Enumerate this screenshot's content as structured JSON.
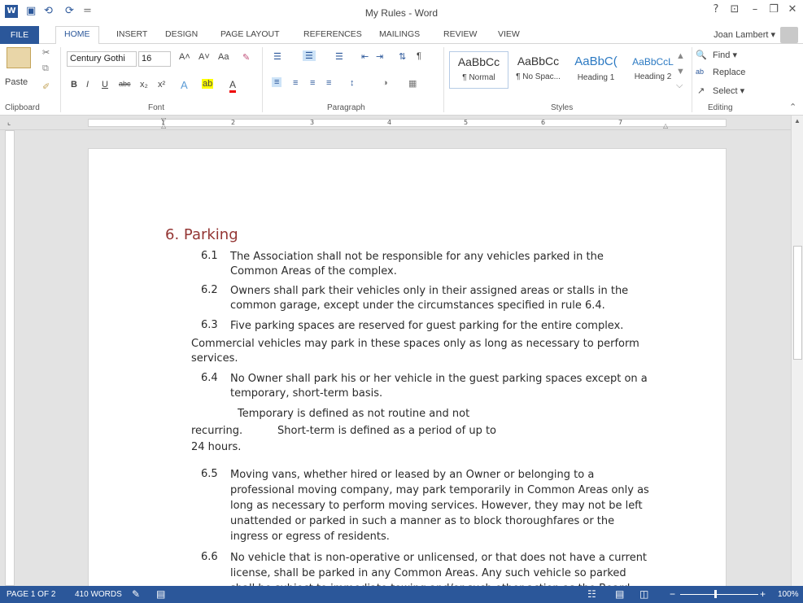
{
  "titlebar": {
    "title": "My Rules - Word",
    "help": "?",
    "ribbon_display": "⊡",
    "minimize": "–",
    "restore": "🗗",
    "close": "✕",
    "undo": "⟲",
    "redo": "⟳",
    "save": "💾",
    "customize": "="
  },
  "tabs": [
    "FILE",
    "HOME",
    "INSERT",
    "DESIGN",
    "PAGE LAYOUT",
    "REFERENCES",
    "MAILINGS",
    "REVIEW",
    "VIEW"
  ],
  "user": {
    "name": "Joan Lambert ▾"
  },
  "ribbon": {
    "clipboard": {
      "paste": "Paste",
      "label": "Clipboard"
    },
    "font": {
      "name": "Century Gothi",
      "size": "16",
      "label": "Font",
      "bold": "B",
      "italic": "I",
      "underline": "U",
      "strike": "abc",
      "sub": "x₂",
      "sup": "x²",
      "grow": "A˄",
      "shrink": "A˅",
      "case": "Aa",
      "clear": "✎",
      "effects": "A",
      "highlight": "ab",
      "color": "A"
    },
    "paragraph": {
      "label": "Paragraph"
    },
    "styles": {
      "label": "Styles",
      "items": [
        {
          "sample": "AaBbCc",
          "name": "¶ Normal"
        },
        {
          "sample": "AaBbCc",
          "name": "¶ No Spac..."
        },
        {
          "sample": "AaBbC(",
          "name": "Heading 1"
        },
        {
          "sample": "AaBbCcL",
          "name": "Heading 2"
        }
      ]
    },
    "editing": {
      "label": "Editing",
      "find": "Find ▾",
      "replace": "Replace",
      "select": "Select ▾"
    }
  },
  "ruler_numbers": [
    "1",
    "2",
    "3",
    "4",
    "5",
    "6",
    "7"
  ],
  "doc": {
    "heading": "6. Parking",
    "p61_num": "6.1",
    "p61_l1": "The Association shall not be responsible for any vehicles parked in the",
    "p61_l2": "Common Areas of the complex.",
    "p62_num": "6.2",
    "p62_l1": "Owners shall park their vehicles only in their assigned areas or stalls in the",
    "p62_l2": "common garage, except under the circumstances specified in rule 6.4.",
    "p63_num": "6.3",
    "p63_l1": "Five parking spaces are reserved for guest parking for the entire complex.",
    "p63_l2": "Commercial vehicles may park in these spaces only as long as necessary to perform",
    "p63_l3": "services.",
    "p64_num": "6.4",
    "p64_l1": "No Owner shall park his or her vehicle in the guest parking spaces except on a",
    "p64_l2": "temporary, short-term basis.",
    "p64_b1": "",
    "p64_b1_text": "Temporary is defined as not routine and not",
    "p64_b2_text": "recurring.",
    "p64_b2": "",
    "p64_b3_text": "Short-term is defined as a period of up to",
    "p64_b4": "24 hours.",
    "p65_num": "6.5",
    "p65_l1": "Moving vans, whether hired or leased by an Owner or belonging to a",
    "p65_l2": "professional moving company, may park temporarily in Common Areas only as",
    "p65_l3": "long as necessary to perform moving services. However, they may not be left",
    "p65_l4": "unattended or parked in such a manner as to block thoroughfares or the",
    "p65_l5": "ingress or egress of residents.",
    "p66_num": "6.6",
    "p66_l1": "No vehicle that is non-operative or unlicensed, or that does not have a current",
    "p66_l2": "license, shall be parked in any Common Areas. Any such vehicle so parked",
    "p66_l3": "shall be subject to immediate towing and/or such other action as the Board"
  },
  "status": {
    "page": "PAGE 1 OF 2",
    "words": "410 WORDS",
    "zoom": "100%"
  },
  "colors": {
    "accent": "#2b579a",
    "heading": "#943634"
  }
}
